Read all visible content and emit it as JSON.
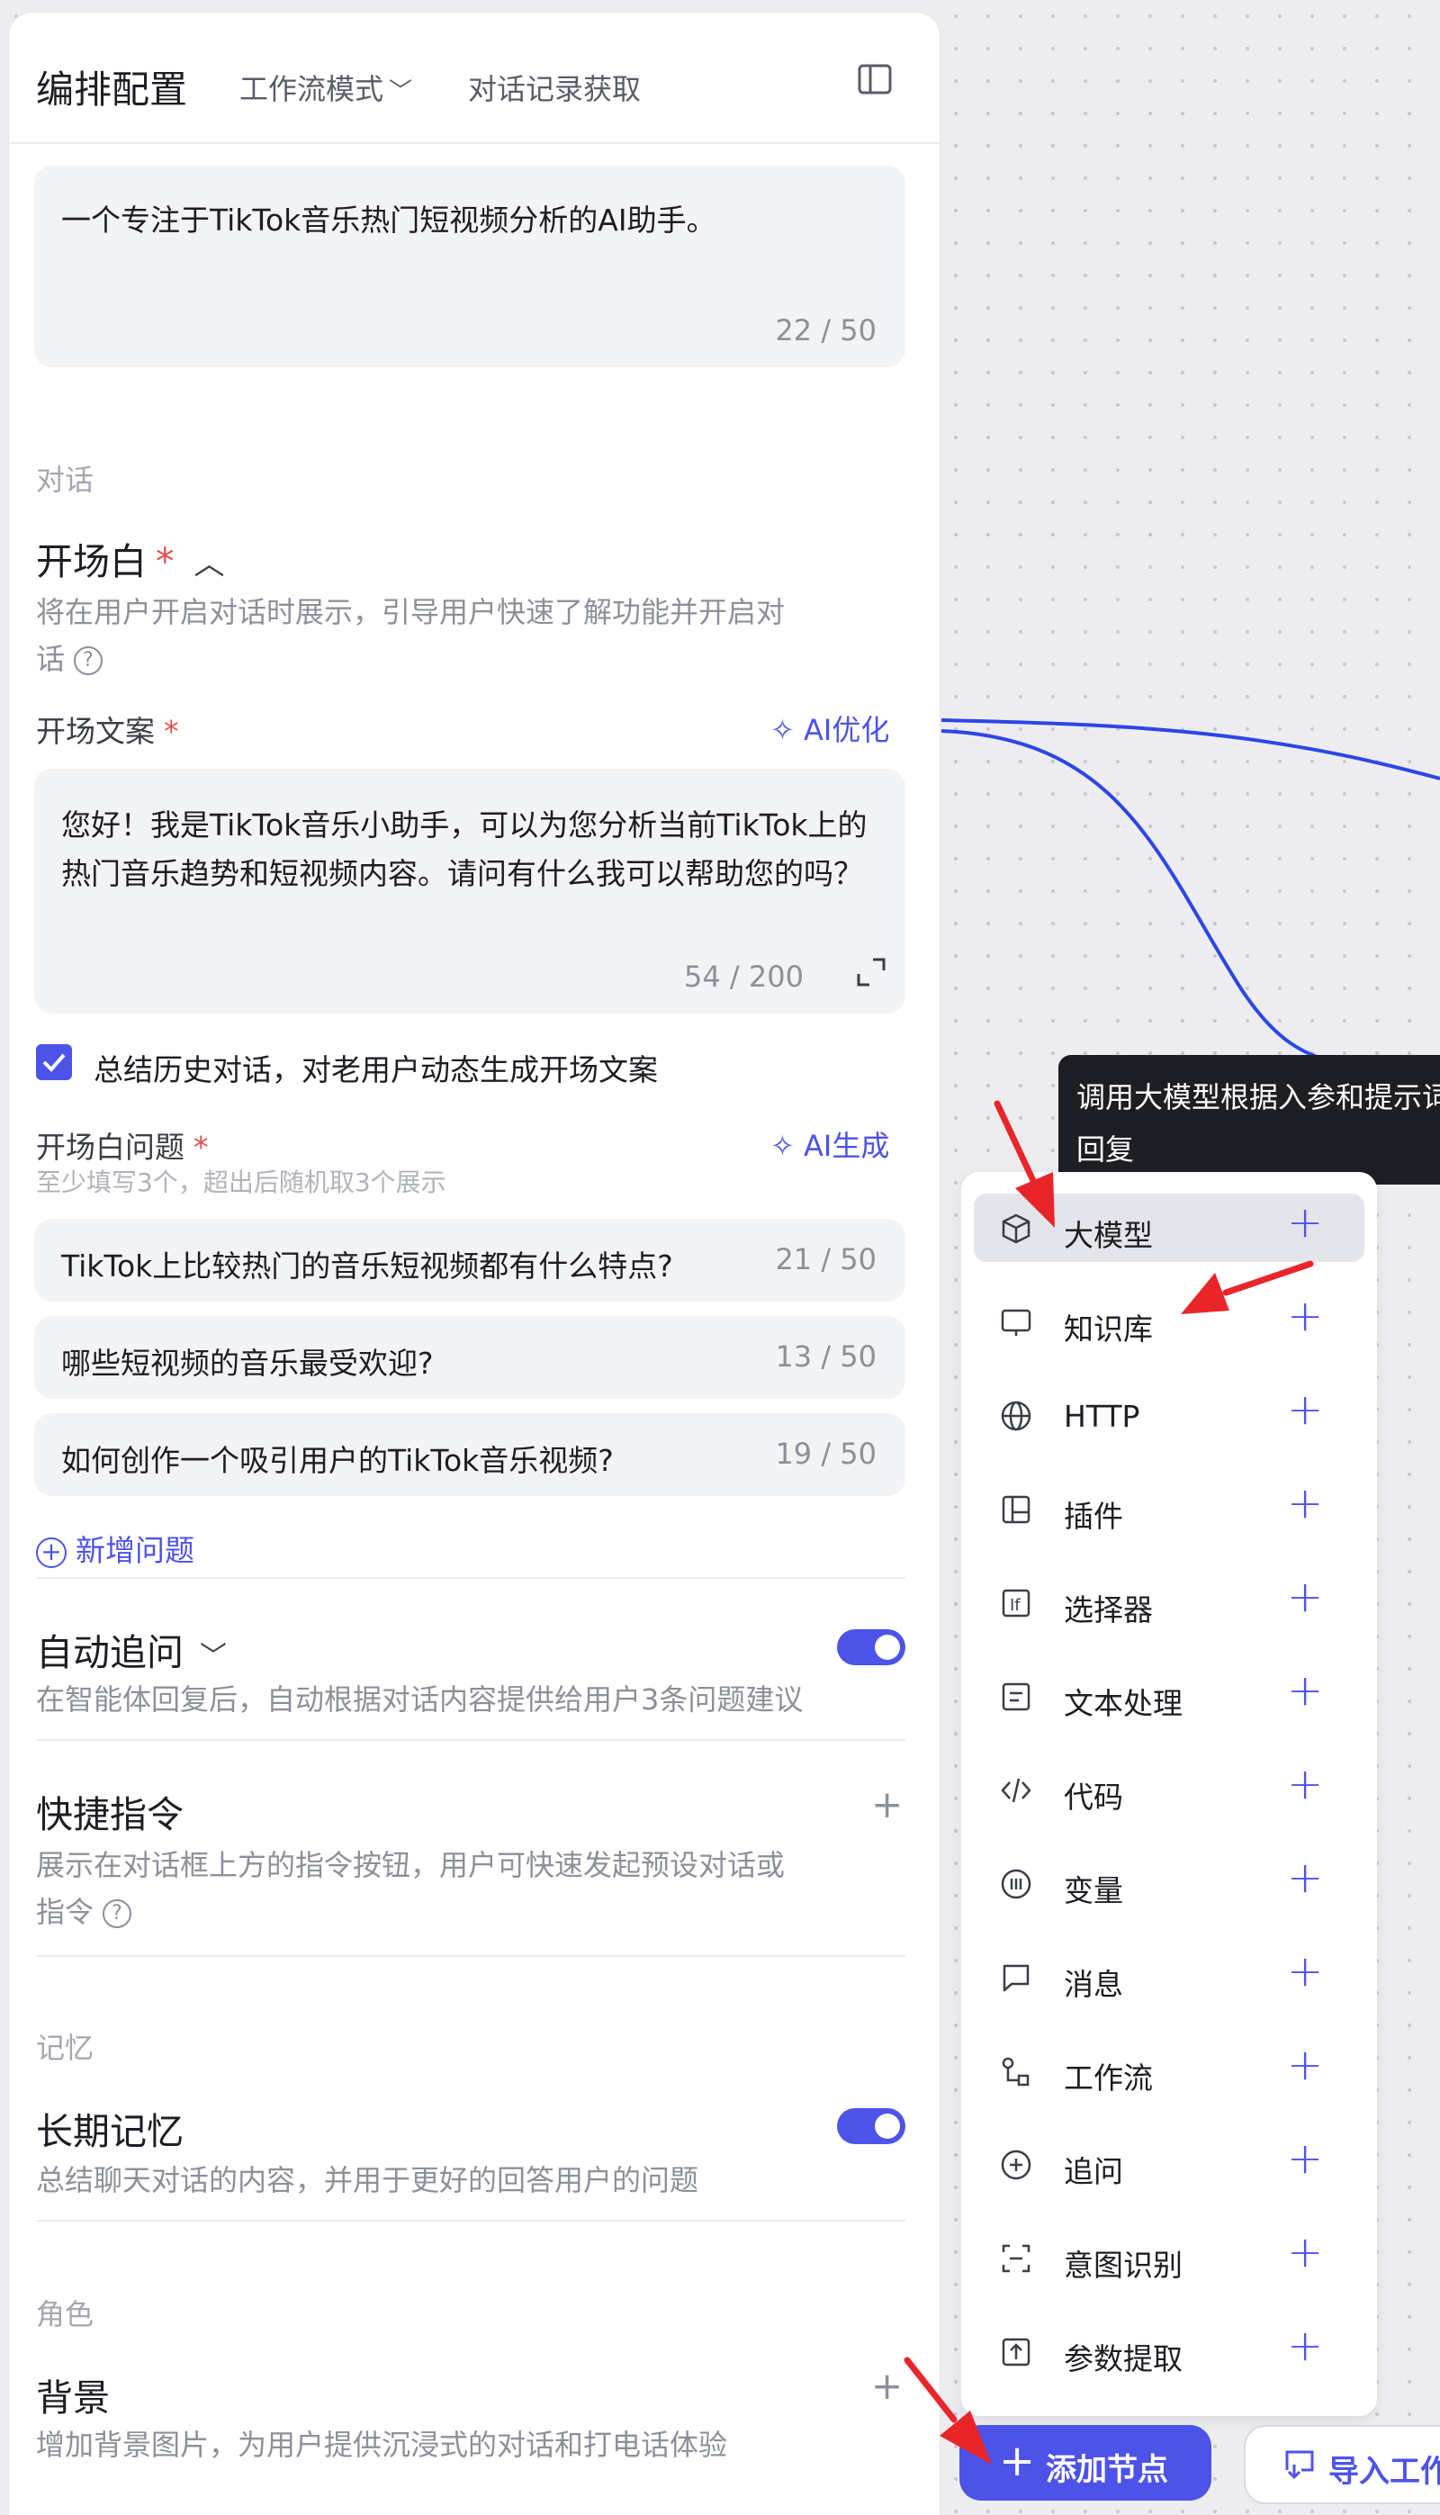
{
  "header": {
    "title": "编排配置",
    "mode_label": "工作流模式",
    "history_label": "对话记录获取"
  },
  "description": {
    "text": "一个专注于TikTok音乐热门短视频分析的AI助手。",
    "count": "22 / 50"
  },
  "dialog": {
    "section_label": "对话",
    "opening": {
      "title": "开场白",
      "required_mark": "*",
      "desc_line1": "将在用户开启对话时展示，引导用户快速了解功能并开启对",
      "desc_line2": "话",
      "copy_label": "开场文案",
      "ai_optimize": "AI优化",
      "welcome_text": "您好！我是TikTok音乐小助手，可以为您分析当前TikTok上的热门音乐趋势和短视频内容。请问有什么我可以帮助您的吗？",
      "welcome_count": "54 / 200",
      "summary_checkbox_label": "总结历史对话，对老用户动态生成开场文案",
      "summary_checked": true,
      "questions_label": "开场白问题",
      "questions_hint": "至少填写3个，超出后随机取3个展示",
      "ai_generate": "AI生成",
      "questions": [
        {
          "text": "TikTok上比较热门的音乐短视频都有什么特点?",
          "count": "21 / 50"
        },
        {
          "text": "哪些短视频的音乐最受欢迎?",
          "count": "13 / 50"
        },
        {
          "text": "如何创作一个吸引用户的TikTok音乐视频?",
          "count": "19 / 50"
        }
      ],
      "add_question": "新增问题"
    },
    "auto_followup": {
      "title": "自动追问",
      "desc": "在智能体回复后，自动根据对话内容提供给用户3条问题建议",
      "enabled": true
    },
    "shortcuts": {
      "title": "快捷指令",
      "desc_line1": "展示在对话框上方的指令按钮，用户可快速发起预设对话或",
      "desc_line2": "指令"
    }
  },
  "memory": {
    "section_label": "记忆",
    "long_term": {
      "title": "长期记忆",
      "desc": "总结聊天对话的内容，并用于更好的回答用户的问题",
      "enabled": true
    }
  },
  "role": {
    "section_label": "角色",
    "background": {
      "title": "背景",
      "desc": "增加背景图片，为用户提供沉浸式的对话和打电话体验"
    }
  },
  "tooltip": {
    "line1": "调用大模型根据入参和提示词生成回复",
    "line2": "回复"
  },
  "node_menu": {
    "items": [
      {
        "label": "大模型",
        "icon": "cube-icon"
      },
      {
        "label": "知识库",
        "icon": "monitor-icon"
      },
      {
        "label": "HTTP",
        "icon": "globe-icon"
      },
      {
        "label": "插件",
        "icon": "plugin-icon"
      },
      {
        "label": "选择器",
        "icon": "if-icon"
      },
      {
        "label": "文本处理",
        "icon": "text-icon"
      },
      {
        "label": "代码",
        "icon": "code-icon"
      },
      {
        "label": "变量",
        "icon": "variable-icon"
      },
      {
        "label": "消息",
        "icon": "message-icon"
      },
      {
        "label": "工作流",
        "icon": "workflow-icon"
      },
      {
        "label": "追问",
        "icon": "followup-icon"
      },
      {
        "label": "意图识别",
        "icon": "intent-icon"
      },
      {
        "label": "参数提取",
        "icon": "extract-icon"
      }
    ]
  },
  "bottom": {
    "add_node": "添加节点",
    "import": "导入工作流"
  },
  "colors": {
    "accent": "#4d53e8",
    "required": "#e25050",
    "annotation_arrow": "#e8262a",
    "connector": "#2d46e6"
  }
}
